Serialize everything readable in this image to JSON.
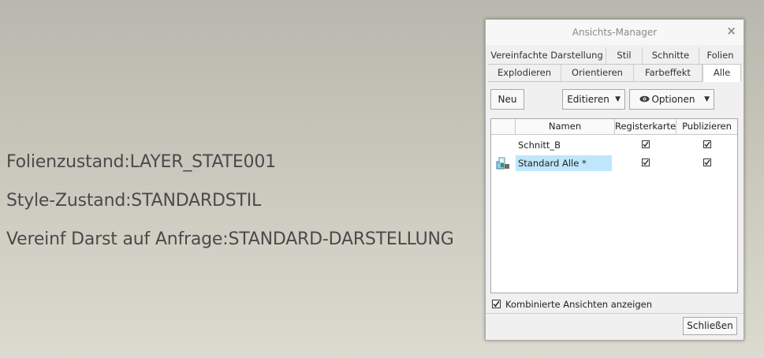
{
  "status": {
    "layer_state": "Folienzustand:LAYER_STATE001",
    "style_state": "Style-Zustand:STANDARDSTIL",
    "simplified_rep": "Vereinf Darst auf Anfrage:STANDARD-DARSTELLUNG"
  },
  "dialog": {
    "title": "Ansichts-Manager",
    "close_glyph": "×",
    "tabs_row1": [
      "Vereinfachte Darstellung",
      "Stil",
      "Schnitte",
      "Folien"
    ],
    "tabs_row2": [
      "Explodieren",
      "Orientieren",
      "Farbeffekt",
      "Alle"
    ],
    "active_tab": "Alle",
    "toolbar": {
      "new_label": "Neu",
      "edit_label": "Editieren",
      "options_label": "Optionen",
      "caret": "▼"
    },
    "table": {
      "columns": [
        "",
        "Namen",
        "Registerkarte",
        "Publizieren"
      ],
      "rows": [
        {
          "name": "Schnitt_B",
          "register": true,
          "publish": true,
          "selected": false,
          "icon": ""
        },
        {
          "name": "Standard Alle *",
          "register": true,
          "publish": true,
          "selected": true,
          "icon": "combined-view-icon"
        }
      ]
    },
    "show_combined_label": "Kombinierte Ansichten anzeigen",
    "show_combined_checked": true,
    "close_button_label": "Schließen"
  }
}
